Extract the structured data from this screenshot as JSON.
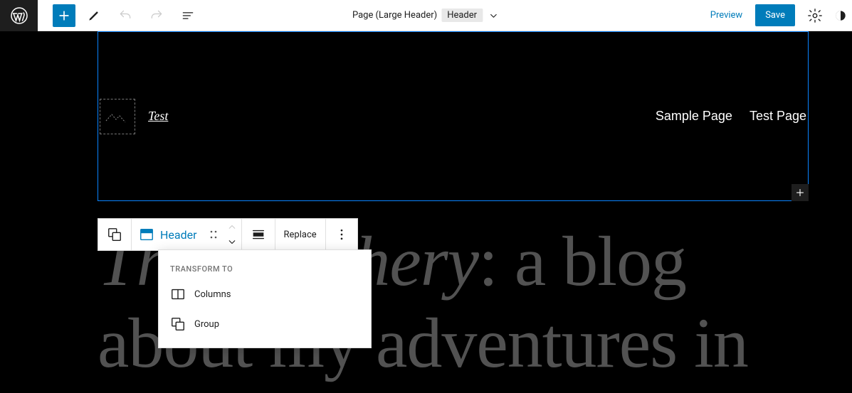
{
  "toolbar": {
    "page_title": "Page (Large Header)",
    "header_badge": "Header",
    "preview": "Preview",
    "save": "Save"
  },
  "header_block": {
    "site_title": "Test",
    "nav": [
      "Sample Page",
      "Test Page"
    ]
  },
  "block_toolbar": {
    "header_label": "Header",
    "replace": "Replace"
  },
  "transform": {
    "title": "TRANSFORM TO",
    "items": [
      {
        "label": "Columns"
      },
      {
        "label": "Group"
      }
    ]
  },
  "content": {
    "title_italic": "The Hatchery",
    "title_rest": ": a blog about my adventures in"
  }
}
